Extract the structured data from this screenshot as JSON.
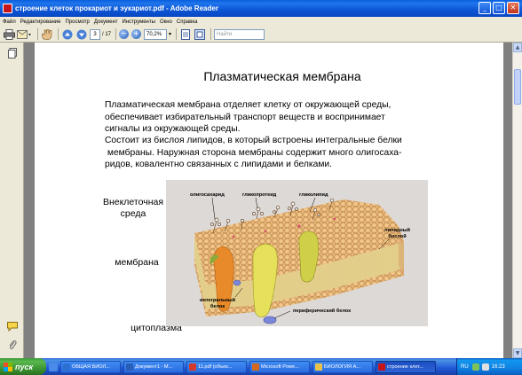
{
  "window": {
    "title": "строение клеток прокариот и эукариот.pdf - Adobe Reader",
    "minimize": "_",
    "maximize": "□",
    "close": "✕"
  },
  "menu": [
    "Файл",
    "Редактирование",
    "Просмотр",
    "Документ",
    "Инструменты",
    "Окно",
    "Справка"
  ],
  "toolbar": {
    "page_current": "3",
    "page_total": "/ 17",
    "zoom": "70,2%",
    "search_placeholder": "Найти",
    "icons": [
      "print-icon",
      "email-icon",
      "hand-icon",
      "prev-page-icon",
      "next-page-icon",
      "zoom-out-icon",
      "zoom-in-icon",
      "fit-width-icon",
      "fit-page-icon"
    ]
  },
  "sidebar": {
    "icons": [
      "pages-icon",
      "comments-icon",
      "attachments-icon"
    ]
  },
  "slide": {
    "title": "Плазматическая мембрана",
    "para1": [
      "Плазматическая мембрана отделяет клетку от окружающей среды,",
      "обеспечивает избирательный транспорт веществ и воспринимает",
      "сигналы из окружающей среды."
    ],
    "para2": [
      "Состоит из бислоя липидов, в который встроены интегральные белки",
      " мембраны. Наружная сторона мембраны содержит много олигосаха-",
      "ридов, ковалентно связанных с липидами и белками."
    ],
    "label_outside": [
      "Внеклеточная",
      "среда"
    ],
    "label_membrane": "мембрана",
    "label_cytoplasm": "цитоплазма",
    "figure": {
      "oligosaccharide": "олигосахарид",
      "glycoprotein": "гликопротеид",
      "glycolipid": "гликолипид",
      "lipid_bilayer": [
        "липидный",
        "бислой"
      ],
      "integral_protein": [
        "интегральный",
        "белок"
      ],
      "peripheral_protein": "периферический белок"
    }
  },
  "taskbar": {
    "start": "пуск",
    "buttons": [
      {
        "label": "ОБЩАЯ БИОЛ...",
        "color": "#2c6fd1"
      },
      {
        "label": "Документ1 - М...",
        "color": "#2a5fb8"
      },
      {
        "label": "11.pdf (объек...",
        "color": "#d33a2c"
      },
      {
        "label": "Microsoft Powe...",
        "color": "#d4691e"
      },
      {
        "label": "БИОЛОГИЯ А...",
        "color": "#e8c34a"
      },
      {
        "label": "строение клет...",
        "color": "#c5151a",
        "active": true
      }
    ],
    "tray_lang": "RU",
    "clock": "16:23"
  }
}
